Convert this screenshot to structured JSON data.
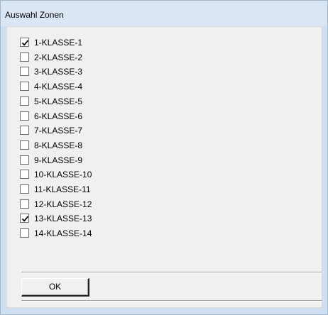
{
  "window": {
    "title": "Auswahl Zonen"
  },
  "zones": [
    {
      "label": "1-KLASSE-1",
      "checked": true
    },
    {
      "label": "2-KLASSE-2",
      "checked": false
    },
    {
      "label": "3-KLASSE-3",
      "checked": false
    },
    {
      "label": "4-KLASSE-4",
      "checked": false
    },
    {
      "label": "5-KLASSE-5",
      "checked": false
    },
    {
      "label": "6-KLASSE-6",
      "checked": false
    },
    {
      "label": "7-KLASSE-7",
      "checked": false
    },
    {
      "label": "8-KLASSE-8",
      "checked": false
    },
    {
      "label": "9-KLASSE-9",
      "checked": false
    },
    {
      "label": "10-KLASSE-10",
      "checked": false
    },
    {
      "label": "11-KLASSE-11",
      "checked": false
    },
    {
      "label": "12-KLASSE-12",
      "checked": false
    },
    {
      "label": "13-KLASSE-13",
      "checked": true
    },
    {
      "label": "14-KLASSE-14",
      "checked": false
    }
  ],
  "buttons": {
    "ok_label": "OK"
  },
  "colors": {
    "title_bg": "#dbe6f4",
    "frame": "#cfe0f2",
    "client_bg": "#f0f0f0"
  }
}
